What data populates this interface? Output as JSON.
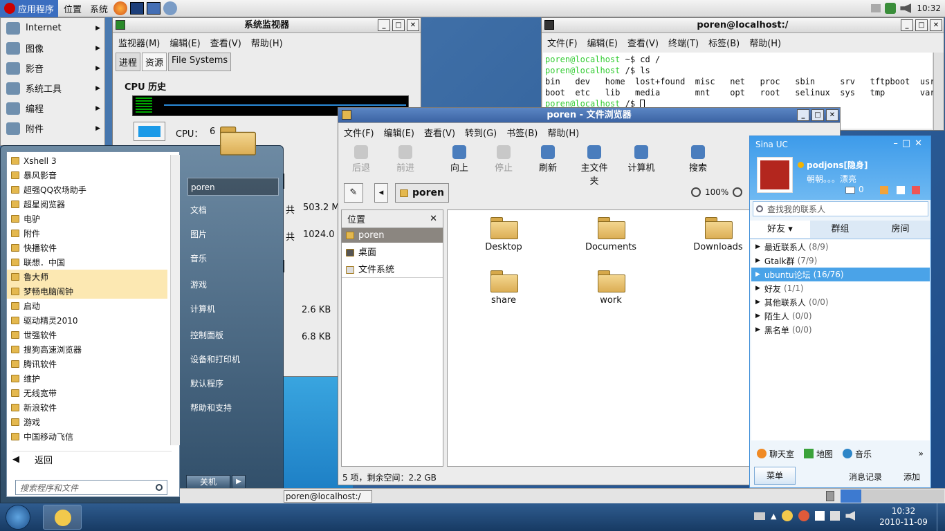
{
  "gnome_panel": {
    "apps": "应用程序",
    "places": "位置",
    "system": "系统",
    "clock": "10:32"
  },
  "app_menu": [
    "Internet",
    "图像",
    "影音",
    "系统工具",
    "编程",
    "附件"
  ],
  "sysmon": {
    "title": "系统监视器",
    "menu": [
      "监视器(M)",
      "编辑(E)",
      "查看(V)",
      "帮助(H)"
    ],
    "tabs": [
      "进程",
      "资源",
      "File Systems"
    ],
    "cpu_history": "CPU 历史",
    "cpu_label": "CPU：",
    "cpu_value": "6",
    "mem_total_1": "共",
    "mem_val_1": "503.2 M",
    "mem_total_2": "共",
    "mem_val_2": "1024.0",
    "net_val_1": "2.6 KB",
    "net_val_2": "6.8 KB"
  },
  "terminal": {
    "title": "poren@localhost:/",
    "menu": [
      "文件(F)",
      "编辑(E)",
      "查看(V)",
      "终端(T)",
      "标签(B)",
      "帮助(H)"
    ],
    "lines": [
      [
        "poren@localhost",
        " ~$ cd /"
      ],
      [
        "poren@localhost",
        " /$ ls"
      ],
      [
        "",
        "bin   dev   home  lost+found  misc   net   proc   sbin     srv   tftpboot  usr"
      ],
      [
        "",
        "boot  etc   lib   media       mnt    opt   root   selinux  sys   tmp       var"
      ],
      [
        "poren@localhost",
        " /$ "
      ]
    ]
  },
  "filebrowser": {
    "title": "poren - 文件浏览器",
    "menu": [
      "文件(F)",
      "编辑(E)",
      "查看(V)",
      "转到(G)",
      "书签(B)",
      "帮助(H)"
    ],
    "toolbar": [
      "后退",
      "前进",
      "向上",
      "停止",
      "刷新",
      "主文件夹",
      "计算机",
      "搜索"
    ],
    "path": "poren",
    "zoom": "100%",
    "side_title": "位置",
    "side_items": [
      "poren",
      "桌面",
      "文件系统"
    ],
    "files": [
      "Desktop",
      "Documents",
      "Downloads",
      "share",
      "work"
    ],
    "status": "5 项，剩余空间：2.2 GB"
  },
  "start_menu": {
    "programs": [
      "Xshell 3",
      "暴风影音",
      "超强QQ农场助手",
      "超星阅览器",
      "电驴",
      "附件",
      "快播软件",
      "联想．中国",
      "鲁大师",
      "梦畅电脑闹钟",
      "启动",
      "驱动精灵2010",
      "世强软件",
      "搜狗高速浏览器",
      "腾讯软件",
      "维护",
      "无线宽带",
      "新浪软件",
      "游戏",
      "中国移动飞信"
    ],
    "back": "返回",
    "search_placeholder": "搜索程序和文件",
    "right_items": [
      "poren",
      "文档",
      "图片",
      "音乐",
      "游戏",
      "计算机",
      "控制面板",
      "设备和打印机",
      "默认程序",
      "帮助和支持"
    ],
    "shutdown": "关机"
  },
  "sina": {
    "title": "Sina UC",
    "user": "podjons[隐身]",
    "status": "朝朝。。。漂亮",
    "count": "0",
    "search": "查找我的联系人",
    "tabs": [
      "好友",
      "群组",
      "房间"
    ],
    "groups": [
      [
        "最近联系人",
        "(8/9)"
      ],
      [
        "Gtalk群",
        "(7/9)"
      ],
      [
        "ubuntu论坛",
        "(16/76)"
      ],
      [
        "好友",
        "(1/1)"
      ],
      [
        "其他联系人",
        "(0/0)"
      ],
      [
        "陌生人",
        "(0/0)"
      ],
      [
        "黑名单",
        "(0/0)"
      ]
    ],
    "bottom": [
      "聊天室",
      "地图",
      "音乐"
    ],
    "menu": "菜单",
    "msg": "消息记录",
    "add": "添加"
  },
  "taskbar": {
    "item": "poren@localhost:/",
    "time": "10:32",
    "date": "2010-11-09"
  }
}
